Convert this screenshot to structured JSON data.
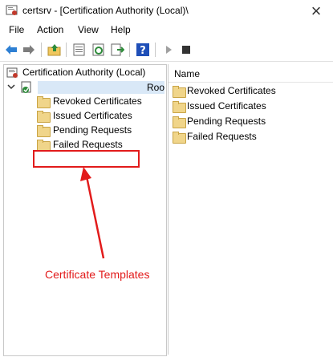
{
  "window": {
    "title": "certsrv - [Certification Authority (Local)\\",
    "close_glyph": "×"
  },
  "menu": {
    "items": [
      "File",
      "Action",
      "View",
      "Help"
    ]
  },
  "tree": {
    "root_label": "Certification Authority (Local)",
    "ca_label": "Roo",
    "children": [
      "Revoked Certificates",
      "Issued Certificates",
      "Pending Requests",
      "Failed Requests"
    ]
  },
  "list": {
    "column_header": "Name",
    "items": [
      "Revoked Certificates",
      "Issued Certificates",
      "Pending Requests",
      "Failed Requests"
    ]
  },
  "annotation": {
    "text": "Certificate Templates",
    "color": "#e21b1b"
  },
  "icons": {
    "back": "back-arrow-icon",
    "forward": "forward-arrow-icon",
    "up": "up-folder-icon",
    "properties": "properties-icon",
    "refresh": "refresh-icon",
    "export": "export-list-icon",
    "help": "help-icon",
    "start": "play-icon",
    "stop": "stop-icon"
  }
}
